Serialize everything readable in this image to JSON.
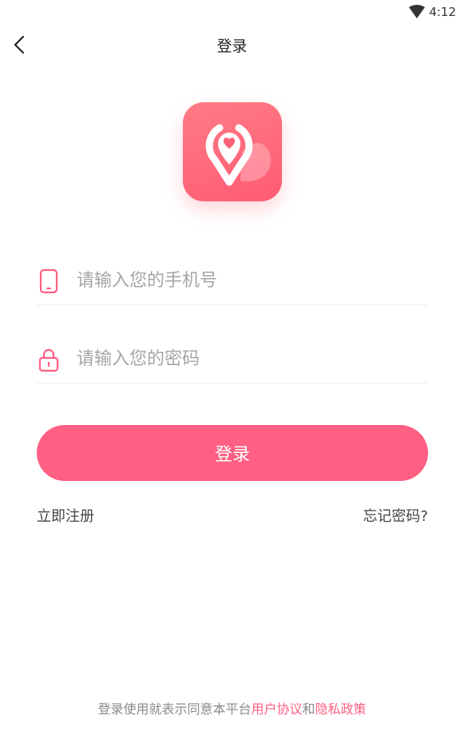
{
  "status_bar": {
    "time": "4:12",
    "wifi_icon": "wifi-icon"
  },
  "nav": {
    "title": "登录",
    "back_icon": "chevron-left-icon"
  },
  "logo": {
    "icon": "location-heart-icon",
    "colors": {
      "start": "#ff7b86",
      "end": "#ff5b73"
    }
  },
  "form": {
    "phone": {
      "placeholder": "请输入您的手机号",
      "value": "",
      "icon": "phone-icon"
    },
    "password": {
      "placeholder": "请输入您的密码",
      "value": "",
      "icon": "lock-icon"
    },
    "submit_label": "登录"
  },
  "links": {
    "register": "立即注册",
    "forgot": "忘记密码?"
  },
  "agreement": {
    "prefix": "登录使用就表示同意本平台",
    "terms": "用户协议",
    "conjunction": "和",
    "privacy": "隐私政策"
  },
  "colors": {
    "accent": "#ff5f82",
    "placeholder": "#a5a5a5",
    "divider": "#eeeeee"
  }
}
